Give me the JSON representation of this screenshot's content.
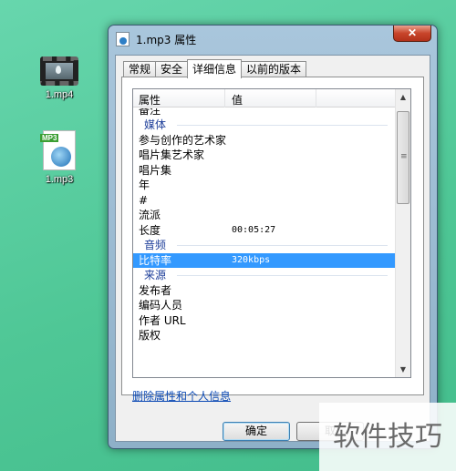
{
  "desktop": {
    "icons": [
      {
        "name": "mp4-file",
        "label": "1.mp4"
      },
      {
        "name": "mp3-file",
        "label": "1.mp3",
        "badge": "MP3"
      }
    ]
  },
  "window": {
    "title": "1.mp3 属性",
    "close_glyph": "✕"
  },
  "tabs": [
    {
      "label": "常规",
      "active": false
    },
    {
      "label": "安全",
      "active": false
    },
    {
      "label": "详细信息",
      "active": true
    },
    {
      "label": "以前的版本",
      "active": false
    }
  ],
  "list": {
    "columns": [
      "属性",
      "值"
    ],
    "rows": [
      {
        "type": "cut",
        "key": "备注",
        "value": ""
      },
      {
        "type": "group",
        "key": "媒体"
      },
      {
        "type": "item",
        "key": "参与创作的艺术家",
        "value": ""
      },
      {
        "type": "item",
        "key": "唱片集艺术家",
        "value": ""
      },
      {
        "type": "item",
        "key": "唱片集",
        "value": ""
      },
      {
        "type": "item",
        "key": "年",
        "value": ""
      },
      {
        "type": "item",
        "key": "#",
        "value": ""
      },
      {
        "type": "item",
        "key": "流派",
        "value": ""
      },
      {
        "type": "item",
        "key": "长度",
        "value": "00:05:27"
      },
      {
        "type": "group",
        "key": "音频"
      },
      {
        "type": "selected",
        "key": "比特率",
        "value": "320kbps"
      },
      {
        "type": "group",
        "key": "来源"
      },
      {
        "type": "item",
        "key": "发布者",
        "value": ""
      },
      {
        "type": "item",
        "key": "编码人员",
        "value": ""
      },
      {
        "type": "item",
        "key": "作者 URL",
        "value": ""
      },
      {
        "type": "item",
        "key": "版权",
        "value": ""
      }
    ]
  },
  "scrollbar": {
    "up": "▲",
    "down": "▼",
    "grip": "≡"
  },
  "remove_link": "删除属性和个人信息",
  "buttons": {
    "ok": "确定",
    "cancel": "取"
  },
  "watermark": "软件技巧"
}
